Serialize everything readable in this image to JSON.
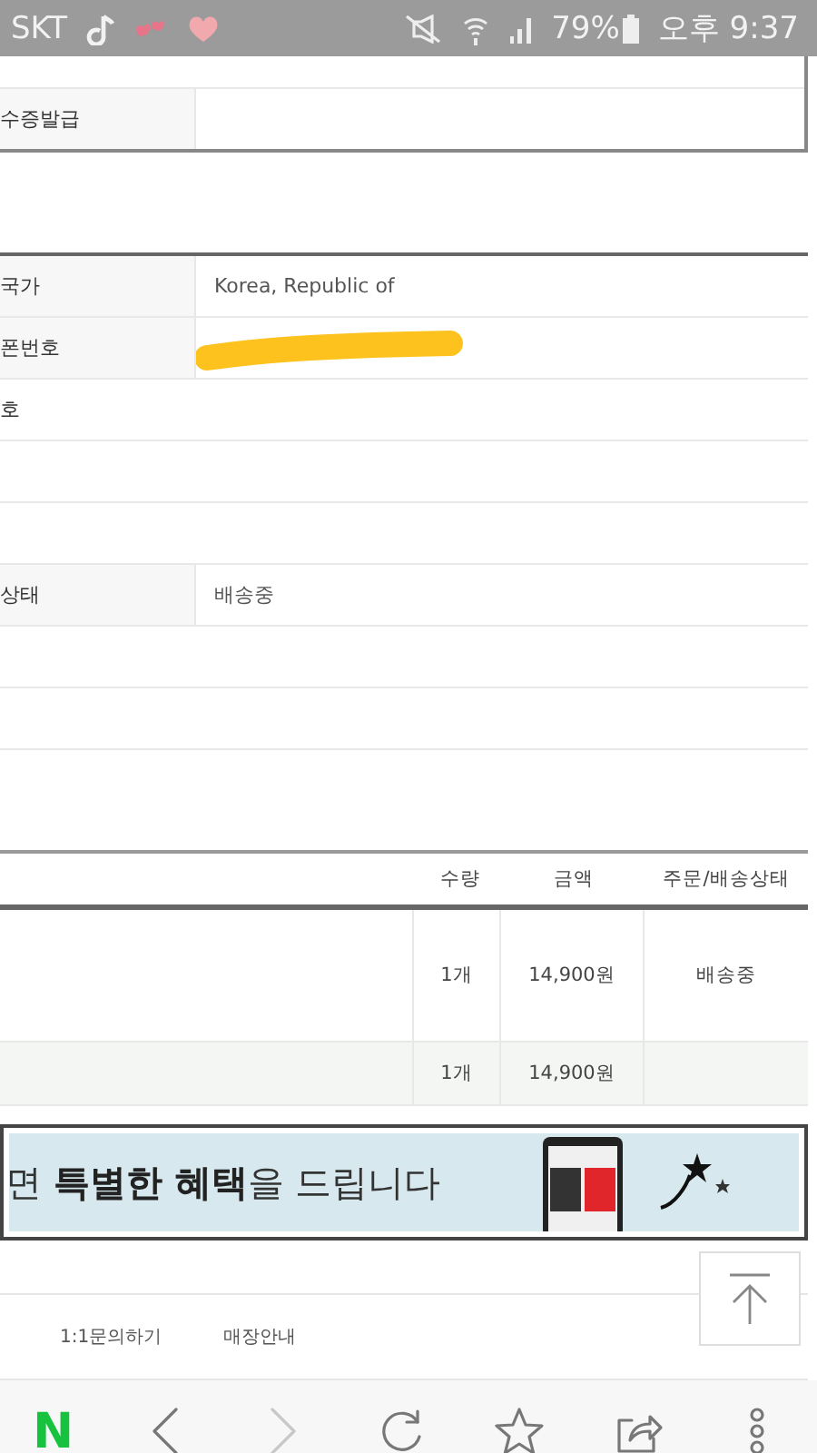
{
  "status_bar": {
    "carrier": "SKT",
    "battery": "79%",
    "time": "오후 9:37"
  },
  "receipt_table": {
    "rows": [
      {
        "label": "수증발급"
      }
    ]
  },
  "shipping_table": {
    "rows": [
      {
        "kind": "labeled",
        "label": "국가",
        "value": "Korea, Republic of"
      },
      {
        "kind": "redacted",
        "label": "폰번호"
      },
      {
        "kind": "plain",
        "label": "호"
      },
      {
        "kind": "blank"
      },
      {
        "kind": "blank"
      },
      {
        "kind": "labeled",
        "label": "상태",
        "value": "배송중"
      },
      {
        "kind": "blank"
      },
      {
        "kind": "blank"
      },
      {
        "kind": "tall"
      }
    ]
  },
  "order_table": {
    "columns": [
      "수량",
      "금액",
      "주문/배송상태"
    ],
    "rows": [
      {
        "quantity": "1개",
        "amount": "14,900원",
        "status": "배송중"
      }
    ],
    "total": {
      "quantity": "1개",
      "amount": "14,900원"
    }
  },
  "banner": {
    "text": "면 **특별한 혜택**을 드립니다"
  },
  "footer_links": [
    "1:1문의하기",
    "매장안내"
  ],
  "browser_toolbar": [
    {
      "kind": "logo",
      "label": "N"
    },
    {
      "kind": "back",
      "disabled": false
    },
    {
      "kind": "forward",
      "disabled": true
    },
    {
      "kind": "reload"
    },
    {
      "kind": "bookmark"
    },
    {
      "kind": "share"
    },
    {
      "kind": "more"
    }
  ]
}
